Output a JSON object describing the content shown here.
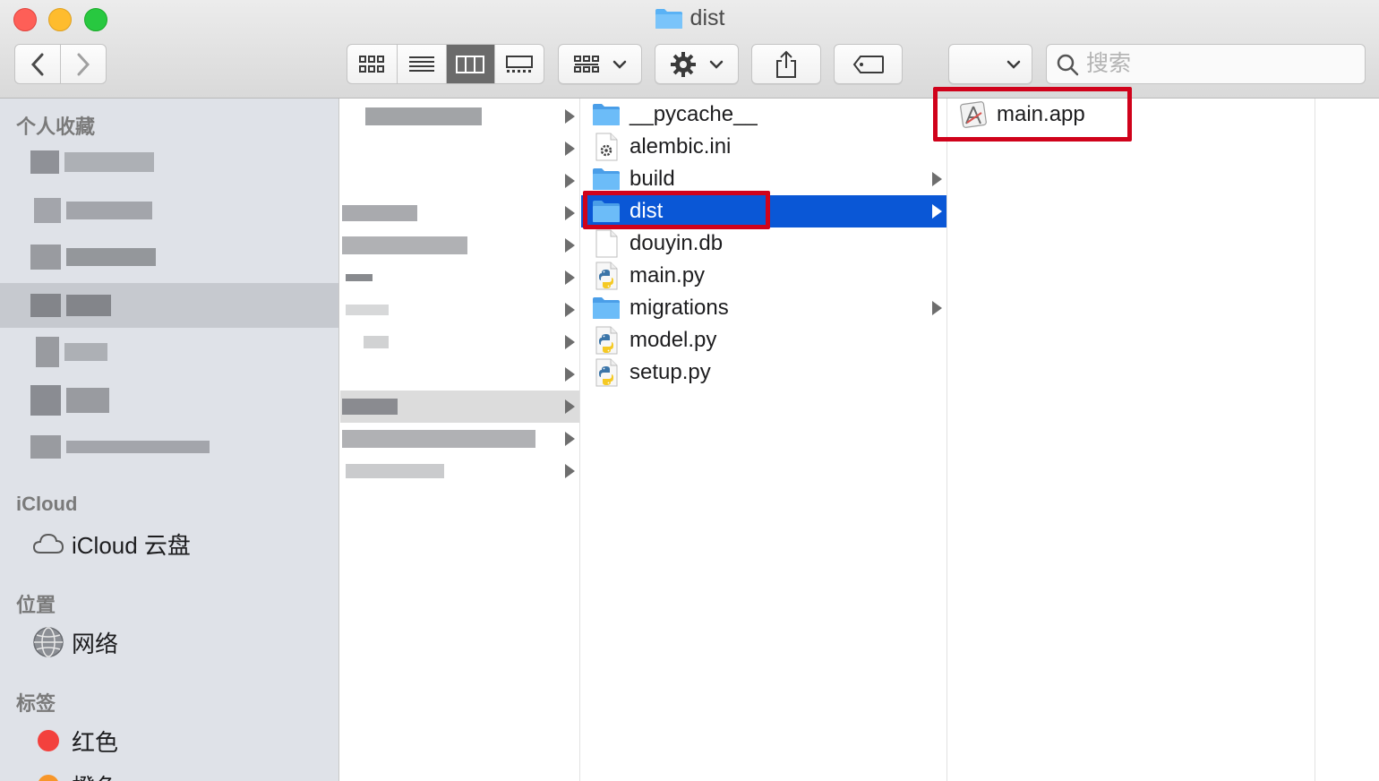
{
  "window": {
    "title": "dist"
  },
  "toolbar": {
    "back_icon": "chevron-left-icon",
    "forward_icon": "chevron-right-icon",
    "view_modes": [
      "icon-view-icon",
      "list-view-icon",
      "column-view-icon",
      "gallery-view-icon"
    ],
    "active_view": "column-view-icon",
    "group_icon": "group-grid-icon",
    "action_icon": "gear-icon",
    "share_icon": "share-icon",
    "tag_icon": "tag-icon",
    "path_dropdown_icon": "chevron-down-icon"
  },
  "search": {
    "placeholder": "搜索",
    "value": ""
  },
  "sidebar": {
    "favorites_header": "个人收藏",
    "icloud_header": "iCloud",
    "icloud_items": [
      {
        "label": "iCloud 云盘",
        "icon": "cloud-icon"
      }
    ],
    "locations_header": "位置",
    "location_items": [
      {
        "label": "网络",
        "icon": "network-globe-icon"
      }
    ],
    "tags_header": "标签",
    "tag_items": [
      {
        "label": "红色",
        "color": "#f3413d"
      },
      {
        "label": "橙色",
        "color": "#f7962a"
      }
    ]
  },
  "columns": {
    "col2": [
      {
        "name": "__pycache__",
        "type": "folder",
        "expandable": false
      },
      {
        "name": "alembic.ini",
        "type": "ini-file",
        "expandable": false
      },
      {
        "name": "build",
        "type": "folder",
        "expandable": true
      },
      {
        "name": "dist",
        "type": "folder",
        "expandable": true,
        "selected": true
      },
      {
        "name": "douyin.db",
        "type": "blank-file",
        "expandable": false
      },
      {
        "name": "main.py",
        "type": "python-file",
        "expandable": false
      },
      {
        "name": "migrations",
        "type": "folder",
        "expandable": true
      },
      {
        "name": "model.py",
        "type": "python-file",
        "expandable": false
      },
      {
        "name": "setup.py",
        "type": "python-file",
        "expandable": false
      }
    ],
    "col3": [
      {
        "name": "main.app",
        "type": "app-bundle"
      }
    ]
  },
  "colors": {
    "selection_blue": "#0a57d6",
    "highlight_red": "#d0021b",
    "folder_blue": "#5ab2f5"
  }
}
